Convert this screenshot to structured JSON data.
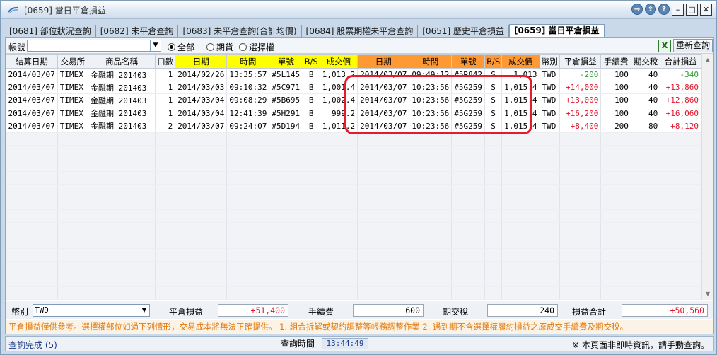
{
  "window": {
    "title": "[0659] 當日平倉損益"
  },
  "tabs": [
    {
      "label": "[0681] 部位狀況查詢"
    },
    {
      "label": "[0682] 未平倉查詢"
    },
    {
      "label": "[0683] 未平倉查詢(合計均價)"
    },
    {
      "label": "[0684] 股票期權未平倉查詢"
    },
    {
      "label": "[0651] 歷史平倉損益"
    },
    {
      "label": "[0659] 當日平倉損益",
      "active": true
    }
  ],
  "filters": {
    "account_label": "帳號",
    "account_value": "",
    "radios": [
      {
        "label": "全部",
        "selected": true
      },
      {
        "label": "期貨",
        "selected": false
      },
      {
        "label": "選擇權",
        "selected": false
      }
    ],
    "excel_label": "X",
    "refresh_label": "重新查詢"
  },
  "table": {
    "columns": [
      "結算日期",
      "交易所",
      "商品名稱",
      "口數",
      "日期",
      "時間",
      "單號",
      "B/S",
      "成交價",
      "日期",
      "時間",
      "單號",
      "B/S",
      "成交價",
      "幣別",
      "平倉損益",
      "手續費",
      "期交稅",
      "合計損益"
    ],
    "rows": [
      [
        "2014/03/07",
        "TIMEX",
        "金融期 201403",
        "1",
        "2014/02/26",
        "13:35:57",
        "#5L145",
        "B",
        "1,013.2",
        "2014/03/07",
        "09:49:12",
        "#5R842",
        "S",
        "1,013",
        "TWD",
        "-200",
        "100",
        "40",
        "-340"
      ],
      [
        "2014/03/07",
        "TIMEX",
        "金融期 201403",
        "1",
        "2014/03/03",
        "09:10:32",
        "#5C971",
        "B",
        "1,001.4",
        "2014/03/07",
        "10:23:56",
        "#5G259",
        "S",
        "1,015.4",
        "TWD",
        "+14,000",
        "100",
        "40",
        "+13,860"
      ],
      [
        "2014/03/07",
        "TIMEX",
        "金融期 201403",
        "1",
        "2014/03/04",
        "09:08:29",
        "#5B695",
        "B",
        "1,002.4",
        "2014/03/07",
        "10:23:56",
        "#5G259",
        "S",
        "1,015.4",
        "TWD",
        "+13,000",
        "100",
        "40",
        "+12,860"
      ],
      [
        "2014/03/07",
        "TIMEX",
        "金融期 201403",
        "1",
        "2014/03/04",
        "12:41:39",
        "#5H291",
        "B",
        "999.2",
        "2014/03/07",
        "10:23:56",
        "#5G259",
        "S",
        "1,015.4",
        "TWD",
        "+16,200",
        "100",
        "40",
        "+16,060"
      ],
      [
        "2014/03/07",
        "TIMEX",
        "金融期 201403",
        "2",
        "2014/03/07",
        "09:24:07",
        "#5D194",
        "B",
        "1,011.2",
        "2014/03/07",
        "10:23:56",
        "#5G259",
        "S",
        "1,015.4",
        "TWD",
        "+8,400",
        "200",
        "80",
        "+8,120"
      ]
    ]
  },
  "totals": {
    "currency_label": "幣別",
    "currency_value": "TWD",
    "pnl_label": "平倉損益",
    "pnl_value": "+51,400",
    "fee_label": "手續費",
    "fee_value": "600",
    "tax_label": "期交稅",
    "tax_value": "240",
    "total_label": "損益合計",
    "total_value": "+50,560"
  },
  "notice": "平倉損益僅供參考。選擇權部位如過下列情形，交易成本將無法正確提供。  1. 組合拆解或契約調整等帳務調整作業  2. 遇到期不含選擇權履約損益之原成交手續費及期交稅。",
  "status": {
    "text": "查詢完成 (5)",
    "time_label": "查詢時間",
    "time_value": "13:44:49",
    "note": "※ 本頁面非即時資訊，請手動查詢。"
  },
  "colors": {
    "header_yellow": "#ffff00",
    "header_orange": "#ff9933",
    "profit": "#e0142b",
    "loss": "#2e9e2e",
    "highlight": "#e41c2d"
  }
}
